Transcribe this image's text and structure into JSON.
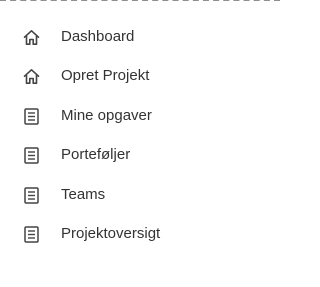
{
  "sidebar": {
    "items": [
      {
        "label": "Dashboard",
        "icon": "home-icon"
      },
      {
        "label": "Opret Projekt",
        "icon": "home-icon"
      },
      {
        "label": "Mine opgaver",
        "icon": "document-icon"
      },
      {
        "label": "Porteføljer",
        "icon": "document-icon"
      },
      {
        "label": "Teams",
        "icon": "document-icon"
      },
      {
        "label": "Projektoversigt",
        "icon": "document-icon"
      }
    ]
  },
  "colors": {
    "text": "#333333",
    "icon": "#444444",
    "background": "#ffffff"
  }
}
